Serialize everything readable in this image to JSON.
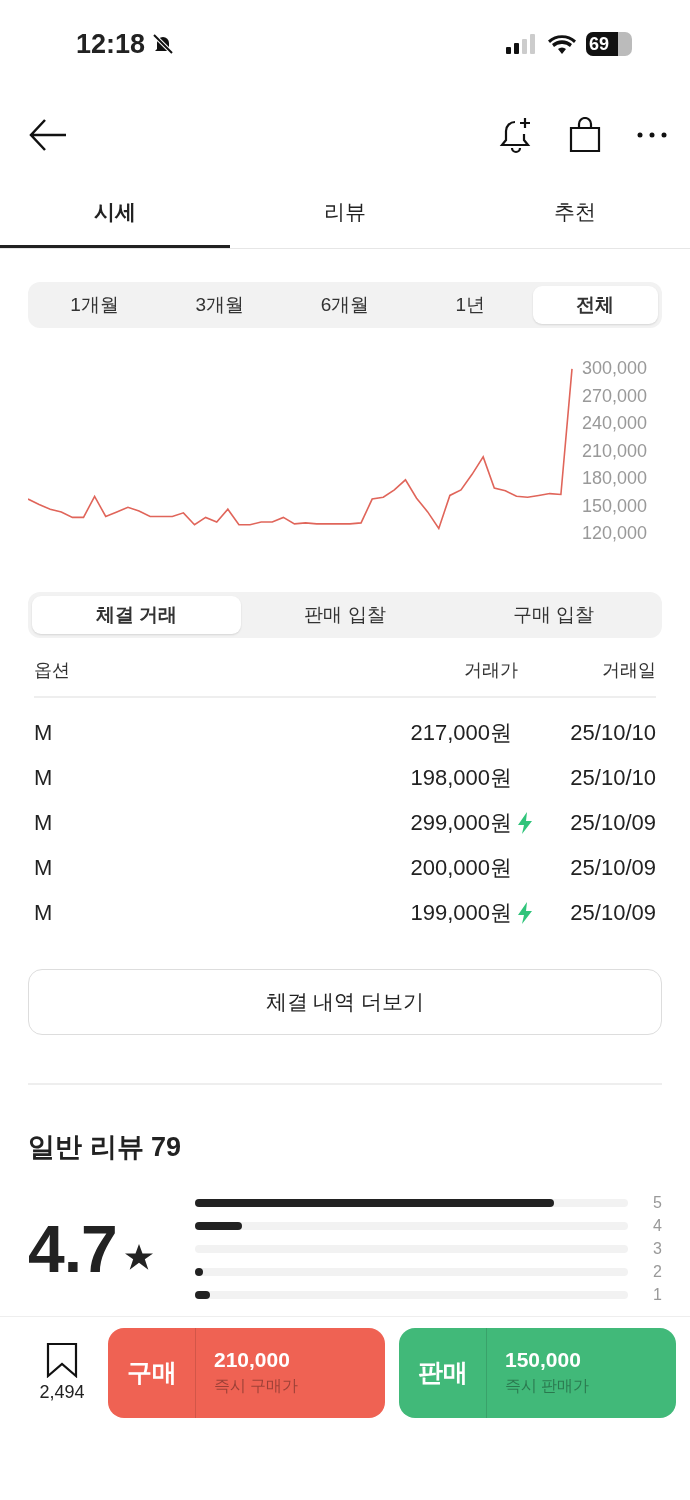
{
  "status_bar": {
    "time": "12:18",
    "silent": true,
    "battery": "69"
  },
  "tabs": [
    {
      "label": "시세",
      "selected": true
    },
    {
      "label": "리뷰",
      "selected": false
    },
    {
      "label": "추천",
      "selected": false
    }
  ],
  "periods": [
    {
      "label": "1개월",
      "selected": false
    },
    {
      "label": "3개월",
      "selected": false
    },
    {
      "label": "6개월",
      "selected": false
    },
    {
      "label": "1년",
      "selected": false
    },
    {
      "label": "전체",
      "selected": true
    }
  ],
  "chart": {
    "chart_data": {
      "type": "line",
      "ylim": [
        120000,
        300000
      ],
      "categories": [
        null,
        null,
        null,
        null,
        null,
        null,
        null,
        null,
        null,
        null,
        null,
        null,
        null,
        null,
        null,
        null,
        null,
        null,
        null,
        null,
        null,
        null,
        null,
        null,
        null,
        null,
        null,
        null,
        null,
        null,
        null,
        null,
        null,
        null,
        null,
        null,
        null,
        null,
        null,
        null,
        null,
        null,
        null,
        null,
        null,
        null,
        null,
        null,
        null,
        null
      ],
      "yticks": [
        {
          "value": 300000,
          "label": "300,000"
        },
        {
          "value": 270000,
          "label": "270,000"
        },
        {
          "value": 240000,
          "label": "240,000"
        },
        {
          "value": 210000,
          "label": "210,000"
        },
        {
          "value": 180000,
          "label": "180,000"
        },
        {
          "value": 150000,
          "label": "150,000"
        },
        {
          "value": 120000,
          "label": "120,000"
        }
      ],
      "series": [
        {
          "color": "#e0655a",
          "values": [
            157000,
            151000,
            146000,
            143000,
            137000,
            137000,
            160000,
            138000,
            143000,
            148000,
            144000,
            138000,
            138000,
            138000,
            142000,
            129000,
            137000,
            132000,
            146000,
            129000,
            129000,
            132000,
            132000,
            137000,
            130000,
            131000,
            130000,
            130000,
            130000,
            130000,
            131000,
            157000,
            159000,
            167000,
            178000,
            158000,
            143000,
            125000,
            161000,
            167000,
            184000,
            203000,
            169000,
            166000,
            160000,
            159000,
            161000,
            163000,
            162000,
            299000
          ]
        }
      ]
    }
  },
  "trade_tabs": [
    {
      "label": "체결 거래",
      "selected": true
    },
    {
      "label": "판매 입찰",
      "selected": false
    },
    {
      "label": "구매 입찰",
      "selected": false
    }
  ],
  "table": {
    "columns": [
      "옵션",
      "거래가",
      "거래일"
    ],
    "rows": [
      {
        "option": "M",
        "price": "217,000원",
        "date": "25/10/10",
        "quick": false
      },
      {
        "option": "M",
        "price": "198,000원",
        "date": "25/10/10",
        "quick": false
      },
      {
        "option": "M",
        "price": "299,000원",
        "date": "25/10/09",
        "quick": true
      },
      {
        "option": "M",
        "price": "200,000원",
        "date": "25/10/09",
        "quick": false
      },
      {
        "option": "M",
        "price": "199,000원",
        "date": "25/10/09",
        "quick": true
      }
    ]
  },
  "more_button": "체결 내역 더보기",
  "reviews": {
    "title": "일반 리뷰 79",
    "rating": "4.7",
    "bars": [
      {
        "label": "5",
        "level": 0.83
      },
      {
        "label": "4",
        "level": 0.11
      },
      {
        "label": "3",
        "level": 0
      },
      {
        "label": "2",
        "level": 0.015
      },
      {
        "label": "1",
        "level": 0.035
      }
    ]
  },
  "bottom_bar": {
    "saves": "2,494",
    "actions": [
      {
        "kind": "buy",
        "label": "구매",
        "price": "210,000",
        "caption": "즉시 구매가"
      },
      {
        "kind": "sell",
        "label": "판매",
        "price": "150,000",
        "caption": "즉시 판매가"
      }
    ]
  }
}
